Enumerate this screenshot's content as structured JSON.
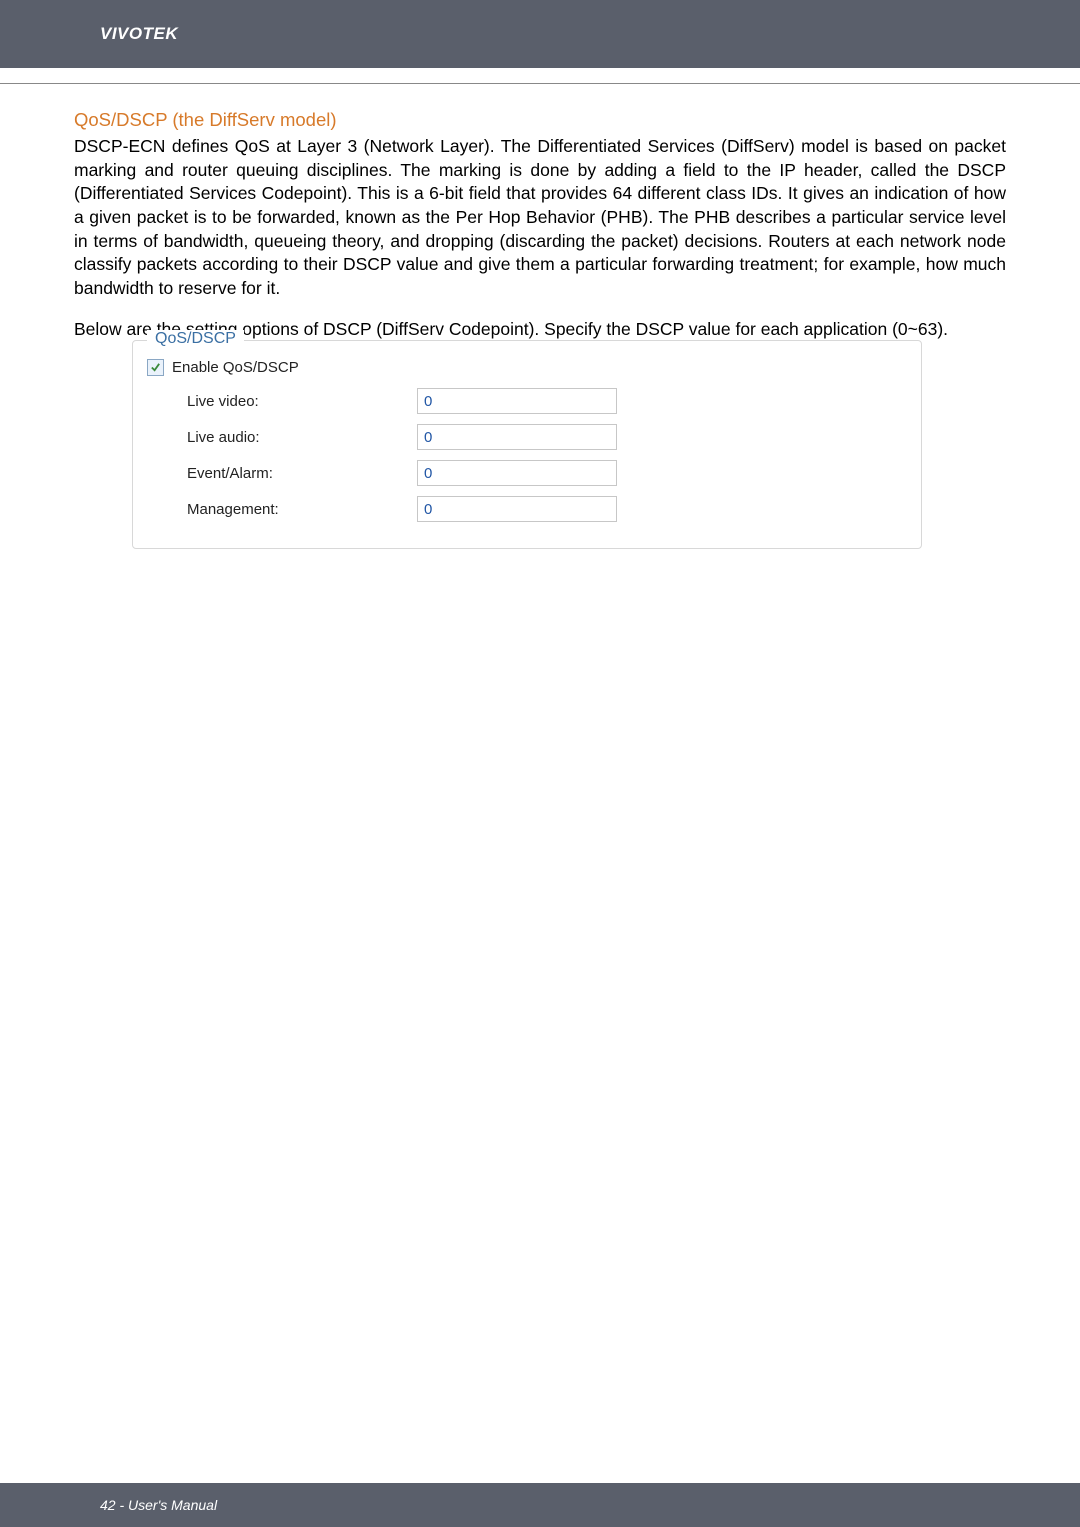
{
  "header": {
    "brand": "VIVOTEK"
  },
  "section": {
    "title": "QoS/DSCP (the DiffServ model)"
  },
  "paragraph1": "DSCP-ECN defines QoS at Layer 3 (Network Layer). The Differentiated Services (DiffServ) model is based on packet marking and router queuing disciplines. The marking is done by adding a field to the IP header, called the DSCP (Differentiated Services Codepoint). This is a 6-bit field that provides 64 different class IDs. It gives an indication of how a given packet is to be forwarded, known as the Per Hop Behavior (PHB). The PHB describes a particular service level in terms of bandwidth, queueing theory, and dropping (discarding the packet) decisions. Routers at each network node classify packets according to their DSCP value and give them a particular forwarding treatment; for example, how much bandwidth to reserve for it.",
  "paragraph2": "Below are the setting options of DSCP (DiffServ Codepoint). Specify the DSCP value for each application (0~63).",
  "fieldset": {
    "legend": "QoS/DSCP",
    "enable_label": "Enable QoS/DSCP",
    "enable_checked": true,
    "rows": [
      {
        "label": "Live video:",
        "value": "0"
      },
      {
        "label": "Live audio:",
        "value": "0"
      },
      {
        "label": "Event/Alarm:",
        "value": "0"
      },
      {
        "label": "Management:",
        "value": "0"
      }
    ]
  },
  "footer": {
    "text": "42 - User's Manual"
  }
}
